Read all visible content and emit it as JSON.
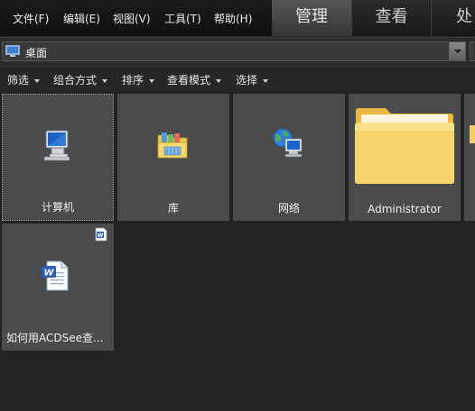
{
  "menu": {
    "items": [
      "文件(F)",
      "编辑(E)",
      "视图(V)",
      "工具(T)",
      "帮助(H)"
    ]
  },
  "mode_tabs": {
    "manage": "管理",
    "view": "查看",
    "process": "处"
  },
  "address": {
    "path": "桌面",
    "icon": "desktop-icon"
  },
  "toolbar": {
    "filter": "筛选",
    "group": "组合方式",
    "sort": "排序",
    "view_mode": "查看模式",
    "select": "选择"
  },
  "tiles": [
    {
      "label": "计算机",
      "icon": "computer-icon"
    },
    {
      "label": "库",
      "icon": "library-icon"
    },
    {
      "label": "网络",
      "icon": "network-icon"
    },
    {
      "label": "Administrator",
      "icon": "folder-icon"
    },
    {
      "label": "如何用ACDSee查...",
      "icon": "word-document-icon",
      "badge": "word-badge-icon"
    }
  ],
  "colors": {
    "background": "#232323",
    "tile": "#4b4b4b",
    "folder": "#f6d36a",
    "active_tab": "#4a4a4a"
  }
}
